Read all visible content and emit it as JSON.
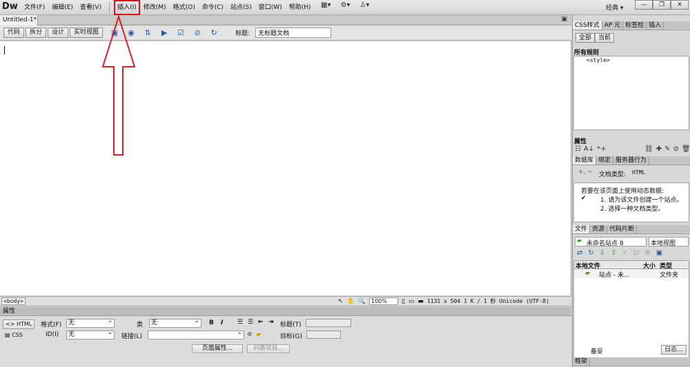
{
  "app": {
    "logo": "Dw",
    "workspace": "经典 ▾"
  },
  "menu": [
    "文件(F)",
    "编辑(E)",
    "查看(V)",
    "插入(I)",
    "修改(M)",
    "格式(O)",
    "命令(C)",
    "站点(S)",
    "窗口(W)",
    "帮助(H)"
  ],
  "menu_toolbar_icons": [
    "layout-icon",
    "gear-icon",
    "people-icon"
  ],
  "window_controls": {
    "minimize": "—",
    "restore": "❐",
    "close": "✕"
  },
  "document": {
    "tab": "Untitled-1*",
    "view_buttons": [
      "代码",
      "拆分",
      "设计",
      "实时视图"
    ],
    "title_label": "标题:",
    "title_value": "无标题文档"
  },
  "status": {
    "tag": "<body>",
    "zoom": "100%",
    "dimensions": "1131 x 504",
    "size_time": "1 K / 1 秒",
    "encoding": "Unicode (UTF-8)"
  },
  "properties": {
    "header": "属性",
    "html_btn": "HTML",
    "css_btn": "CSS",
    "format_label": "格式(F)",
    "format_value": "无",
    "class_label": "类",
    "class_value": "无",
    "id_label": "ID(I)",
    "id_value": "无",
    "link_label": "链接(L)",
    "link_value": "",
    "title_label": "标题(T)",
    "target_label": "目标(G)",
    "page_props_btn": "页面属性...",
    "list_items_btn": "列表项目..."
  },
  "right_panel": {
    "css_tabs": [
      "CSS样式",
      "AP 元",
      "标签检",
      "插入"
    ],
    "css_mode_buttons": [
      "全部",
      "当前"
    ],
    "all_rules_label": "所有规则",
    "style_rule": "<style>",
    "attributes_label": "属性",
    "data_tabs": [
      "数据库",
      "绑定",
      "服务器行为"
    ],
    "doc_type_label": "文档类型:",
    "doc_type_value": "HTML",
    "dynamic_intro": "若要在该页面上使用动态数据:",
    "step1": "1. 请为该文件创建一个站点。",
    "step2": "2. 选择一种文档类型。",
    "files_tabs": [
      "文件",
      "资源",
      "代码片断"
    ],
    "site_select": "未命名站点 8",
    "view_select": "本地视图",
    "file_headers": [
      "本地文件",
      "大小",
      "类型"
    ],
    "site_row_name": "站点 - 未...",
    "site_row_type": "文件夹",
    "footer_btn": "日志...",
    "footer_left": "备妥",
    "frames_tab": "框架"
  },
  "colors": {
    "annotation": "#d42020"
  }
}
